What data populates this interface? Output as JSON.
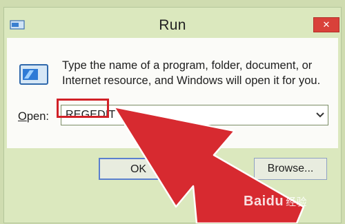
{
  "window": {
    "title": "Run",
    "close_glyph": "✕"
  },
  "message": "Type the name of a program, folder, document, or Internet resource, and Windows will open it for you.",
  "open": {
    "label_underlined": "O",
    "label_rest": "pen:",
    "value": "REGEDIT"
  },
  "buttons": {
    "ok": "OK",
    "browse": "Browse..."
  },
  "watermark": {
    "brand": "Baidu",
    "sub": "经验"
  },
  "colors": {
    "annotation_arrow": "#d72a30",
    "highlight_box": "#d12027",
    "close_button": "#d9413a"
  }
}
